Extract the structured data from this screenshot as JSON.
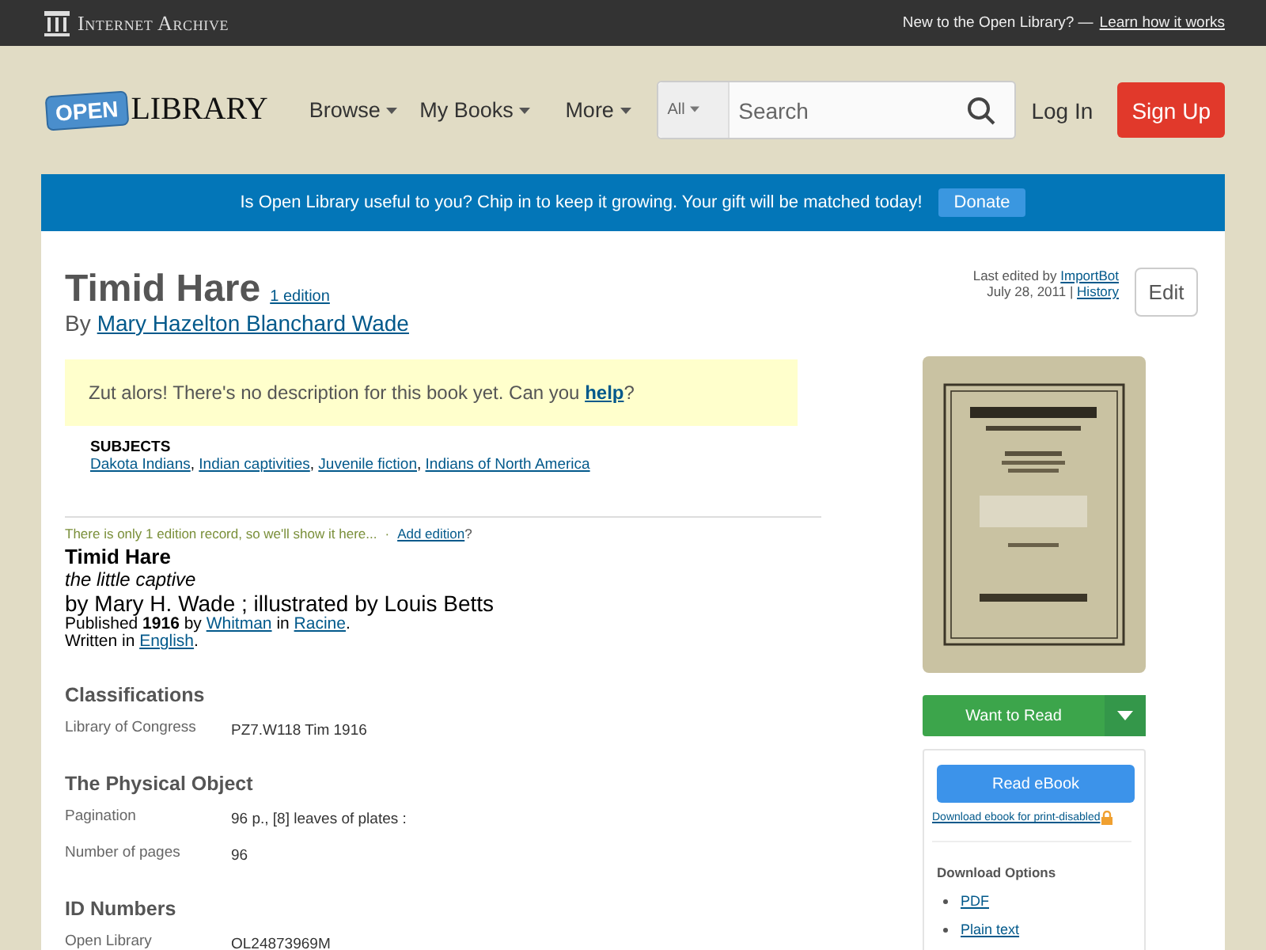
{
  "top_bar": {
    "brand": "Internet Archive",
    "promo": "New to the Open Library? —",
    "promo_link": "Learn how it works"
  },
  "header": {
    "logo_sign": "OPEN",
    "logo_text": "LIBRARY",
    "nav": [
      {
        "label": "Browse"
      },
      {
        "label": "My Books"
      },
      {
        "label": "More"
      }
    ],
    "search": {
      "scope": "All",
      "placeholder": "Search"
    },
    "login": "Log In",
    "signup": "Sign Up"
  },
  "banner": {
    "text": "Is Open Library useful to you? Chip in to keep it growing. Your gift will be matched today!",
    "button": "Donate"
  },
  "work": {
    "title": "Timid Hare",
    "edition_link": "1 edition",
    "by": "By",
    "author": "Mary Hazelton Blanchard Wade"
  },
  "edit_info": {
    "label": "Last edited by",
    "user": "ImportBot",
    "date": "July 28, 2011 |",
    "history": "History",
    "button": "Edit"
  },
  "description": {
    "text": "Zut alors! There's no description for this book yet. Can you",
    "link": "help",
    "after": "?"
  },
  "subjects": {
    "heading": "SUBJECTS",
    "separator": ",",
    "items": [
      "Dakota Indians",
      "Indian captivities",
      "Juvenile fiction",
      "Indians of North America"
    ]
  },
  "edition": {
    "notice": "There is only 1 edition record, so we'll show it here...",
    "separator": "·",
    "add_link": "Add edition",
    "add_after": "?",
    "title": "Timid Hare",
    "subtitle": "the little captive",
    "byline": "by Mary H. Wade ; illustrated by Louis Betts",
    "published": "Published **1916** by",
    "publisher": "Whitman",
    "in": "in",
    "place": "Racine",
    "period": ".",
    "written": "Written in",
    "language": "English",
    "period2": "."
  },
  "sections": [
    {
      "heading": "Classifications",
      "rows": [
        {
          "label": "Library of Congress",
          "value": "PZ7.W118 Tim 1916"
        }
      ]
    },
    {
      "heading": "The Physical Object",
      "rows": [
        {
          "label": "Pagination",
          "value": "96 p., [8] leaves of plates :"
        },
        {
          "label": "Number of pages",
          "value": "96"
        }
      ]
    },
    {
      "heading": "ID Numbers",
      "rows": [
        {
          "label": "Open Library",
          "value": "OL24873969M"
        }
      ]
    }
  ],
  "sidebar": {
    "cover": {
      "kind": "picture"
    },
    "want_to_read": "Want to Read",
    "read_ebook": "Read eBook",
    "print_disabled": "Download ebook for print-disabled",
    "download_heading": "Download Options",
    "downloads": [
      "PDF",
      "Plain text"
    ]
  }
}
